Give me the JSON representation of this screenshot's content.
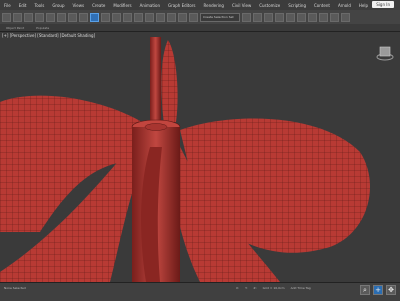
{
  "menu": [
    "File",
    "Edit",
    "Tools",
    "Group",
    "Views",
    "Create",
    "Modifiers",
    "Animation",
    "Graph Editors",
    "Rendering",
    "Civil View",
    "Customize",
    "Scripting",
    "Content",
    "Arnold",
    "Help"
  ],
  "signin_label": "Sign In",
  "toolbar": {
    "selection_set_label": "Create Selection Set"
  },
  "ribbon": [
    "Object Paint",
    "Populate"
  ],
  "viewport": {
    "label": "[+] [Perspective] [Standard] [Default Shading]",
    "object_color": "#b83a34",
    "wire_color": "#5a1715"
  },
  "status": {
    "selection": "None Selected",
    "xyz": [
      "X:",
      "Y:",
      "Z:"
    ],
    "grid": "Grid = 10,0cm",
    "add_time_tag": "Add Time Tag"
  }
}
